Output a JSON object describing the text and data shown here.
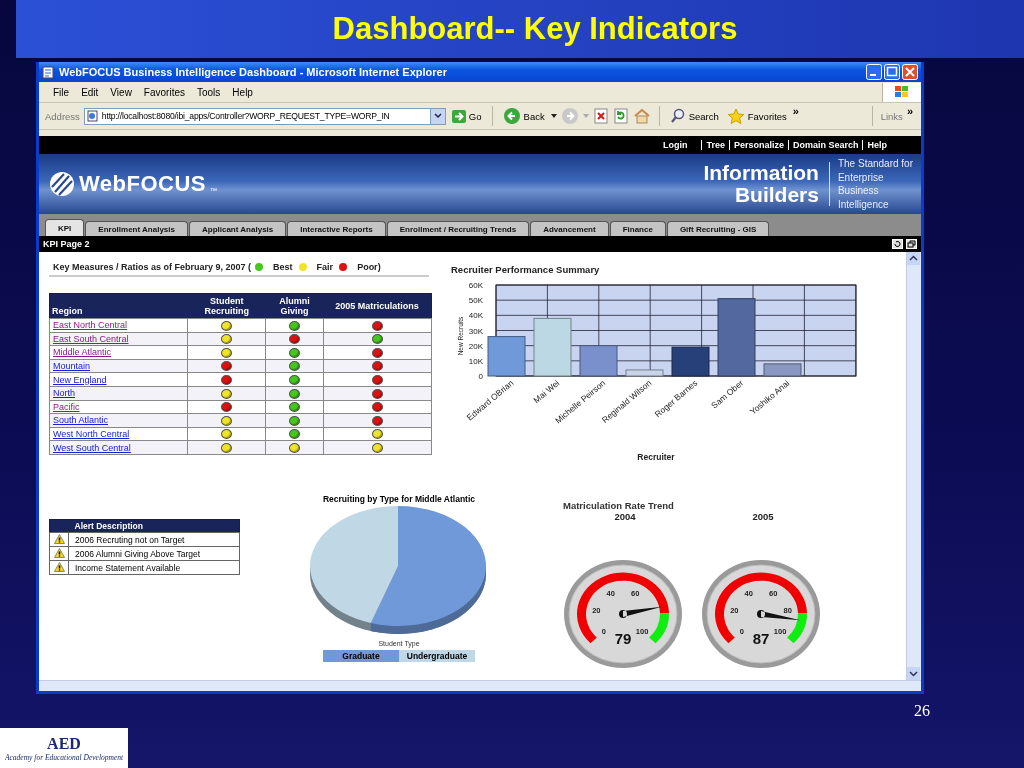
{
  "slide": {
    "title": "Dashboard-- Key Indicators",
    "page_number": "26",
    "logo": {
      "mark": "AED",
      "tagline": "Academy for Educational Development"
    }
  },
  "window": {
    "title": "WebFOCUS Business Intelligence Dashboard - Microsoft Internet Explorer"
  },
  "menu": [
    "File",
    "Edit",
    "View",
    "Favorites",
    "Tools",
    "Help"
  ],
  "toolbar": {
    "address_label": "Address",
    "url": "http://localhost:8080/ibi_apps/Controller?WORP_REQUEST_TYPE=WORP_IN",
    "go": "Go",
    "back": "Back",
    "search": "Search",
    "favorites": "Favorites",
    "more": "»",
    "links": "Links",
    "links_more": "»"
  },
  "top_nav": [
    "Login",
    "Tree",
    "Personalize",
    "Domain Search",
    "Help"
  ],
  "banner": {
    "product": "WebFOCUS",
    "trademark": "™",
    "company": [
      "Information",
      "Builders"
    ],
    "tagline": [
      "The Standard for",
      "Enterprise",
      "Business",
      "Intelligence"
    ]
  },
  "tabs": [
    {
      "label": "KPI",
      "selected": true
    },
    {
      "label": "Enrollment Analysis",
      "selected": false
    },
    {
      "label": "Applicant Analysis",
      "selected": false
    },
    {
      "label": "Interactive Reports",
      "selected": false
    },
    {
      "label": "Enrollment / Recruiting Trends",
      "selected": false
    },
    {
      "label": "Advancement",
      "selected": false
    },
    {
      "label": "Finance",
      "selected": false
    },
    {
      "label": "Gift Recruiting - GIS",
      "selected": false
    }
  ],
  "page_bar": {
    "title": "KPI Page 2"
  },
  "key_measures": {
    "heading": "Key Measures / Ratios as of February 9, 2007 (",
    "legend": [
      {
        "label": "Best",
        "color": "#44c81c"
      },
      {
        "label": "Fair",
        "color": "#f0e428"
      },
      {
        "label": "Poor)",
        "color": "#e01010"
      }
    ],
    "columns": [
      "Region",
      "Student Recruiting",
      "Alumni Giving",
      "2005 Matriculations"
    ],
    "rows": [
      {
        "region": "East North Central",
        "visited": true,
        "indicators": [
          {
            "color": "#f0e428"
          },
          {
            "color": "#44c81c"
          },
          {
            "color": "#e01010"
          }
        ]
      },
      {
        "region": "East South Central",
        "visited": true,
        "indicators": [
          {
            "color": "#f0e428"
          },
          {
            "color": "#e01010"
          },
          {
            "color": "#44c81c"
          }
        ]
      },
      {
        "region": "Middle Atlantic",
        "visited": true,
        "indicators": [
          {
            "color": "#f0e428"
          },
          {
            "color": "#44c81c"
          },
          {
            "color": "#e01010"
          }
        ]
      },
      {
        "region": "Mountain",
        "visited": false,
        "indicators": [
          {
            "color": "#e01010"
          },
          {
            "color": "#44c81c"
          },
          {
            "color": "#e01010"
          }
        ]
      },
      {
        "region": "New England",
        "visited": false,
        "indicators": [
          {
            "color": "#e01010"
          },
          {
            "color": "#44c81c"
          },
          {
            "color": "#e01010"
          }
        ]
      },
      {
        "region": "North",
        "visited": false,
        "indicators": [
          {
            "color": "#f0e428"
          },
          {
            "color": "#44c81c"
          },
          {
            "color": "#e01010"
          }
        ]
      },
      {
        "region": "Pacific",
        "visited": true,
        "indicators": [
          {
            "color": "#e01010"
          },
          {
            "color": "#44c81c"
          },
          {
            "color": "#e01010"
          }
        ]
      },
      {
        "region": "South Atlantic",
        "visited": false,
        "indicators": [
          {
            "color": "#f0e428"
          },
          {
            "color": "#44c81c"
          },
          {
            "color": "#e01010"
          }
        ]
      },
      {
        "region": "West North Central",
        "visited": false,
        "indicators": [
          {
            "color": "#f0e428"
          },
          {
            "color": "#44c81c"
          },
          {
            "color": "#f0e428"
          }
        ]
      },
      {
        "region": "West South Central",
        "visited": false,
        "indicators": [
          {
            "color": "#f0e428"
          },
          {
            "color": "#f0e428"
          },
          {
            "color": "#f0e428"
          }
        ]
      }
    ]
  },
  "recruiter_chart": {
    "chart_data": {
      "type": "bar",
      "title": "Recruiter Performance Summary",
      "xlabel": "Recruiter",
      "ylabel": "New Recruits",
      "categories": [
        "Edward OBrian",
        "Mai Wei",
        "Michelle Peirson",
        "Reginald Wilson",
        "Roger Barnes",
        "Sam Ober",
        "Yoshiko Anai"
      ],
      "values": [
        26000,
        38000,
        20000,
        4000,
        19000,
        51000,
        8000
      ],
      "ylim": [
        0,
        60000
      ],
      "grid": true,
      "yticks": [
        {
          "value": 0,
          "label": "0"
        },
        {
          "value": 10000,
          "label": "10K"
        },
        {
          "value": 20000,
          "label": "20K"
        },
        {
          "value": 30000,
          "label": "30K"
        },
        {
          "value": 40000,
          "label": "40K"
        },
        {
          "value": 50000,
          "label": "50K"
        },
        {
          "value": 60000,
          "label": "60K"
        }
      ]
    }
  },
  "alerts": {
    "header": "Alert Description",
    "rows": [
      "2006 Recruting not on Target",
      "2006 Alumni Giving Above Target",
      "Income Statement Available"
    ]
  },
  "pie": {
    "title": "Recruiting by Type for Middle Atlantic",
    "legend_title": "Student Type",
    "legend": [
      {
        "label": "Graduate",
        "color": "#6f99d8"
      },
      {
        "label": "Undergraduate",
        "color": "#c0d8e6"
      }
    ]
  },
  "gauges": {
    "title": "Matriculation Rate Trend",
    "items": [
      {
        "year": "2004",
        "value": "79",
        "ticks": [
          "0",
          "20",
          "40",
          "60",
          "100"
        ]
      },
      {
        "year": "2005",
        "value": "87",
        "ticks": [
          "0",
          "20",
          "40",
          "60",
          "80",
          "100"
        ]
      }
    ]
  }
}
